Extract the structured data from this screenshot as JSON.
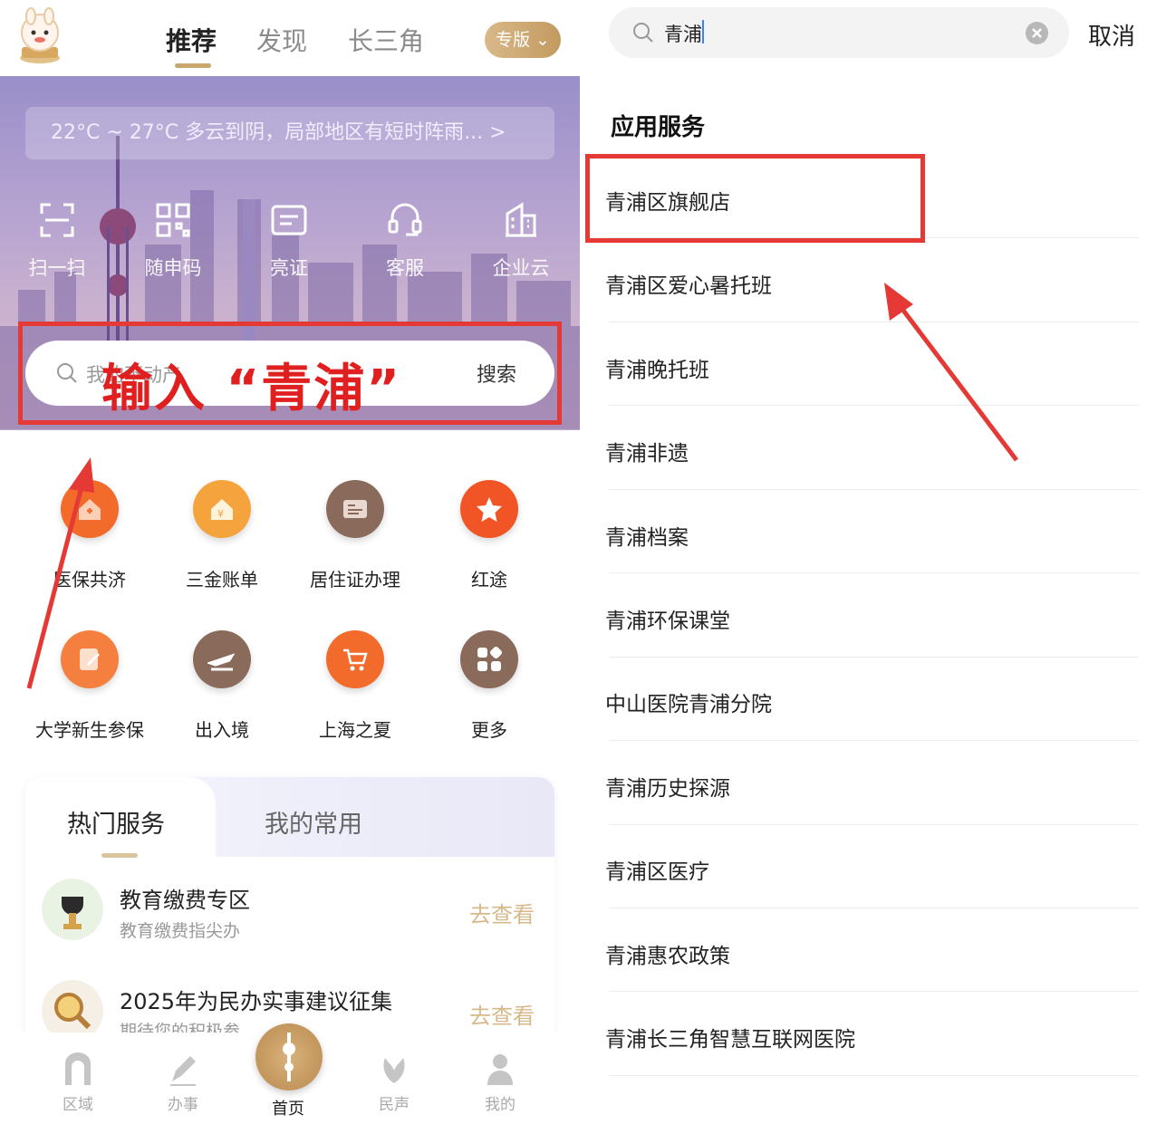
{
  "left": {
    "top_tabs": [
      "推荐",
      "发现",
      "长三角"
    ],
    "edition_label": "专版",
    "weather": "22°C ~ 27°C  多云到阴，局部地区有短时阵雨... >",
    "quick_actions": [
      "扫一扫",
      "随申码",
      "亮证",
      "客服",
      "企业云"
    ],
    "search": {
      "placeholder": "我的不动产",
      "button": "搜索"
    },
    "annotation": "输入 “青浦”",
    "services": [
      "医保共济",
      "三金账单",
      "居住证办理",
      "红途",
      "大学新生参保",
      "出入境",
      "上海之夏",
      "更多"
    ],
    "hot_tabs": [
      "热门服务",
      "我的常用"
    ],
    "hot_items": [
      {
        "title": "教育缴费专区",
        "subtitle": "教育缴费指尖办",
        "action": "去查看"
      },
      {
        "title": "2025年为民办实事建议征集",
        "subtitle": "期待您的积极参",
        "action": "去查看"
      }
    ],
    "bottom_nav": [
      "区域",
      "办事",
      "首页",
      "民声",
      "我的"
    ]
  },
  "right": {
    "search_value": "青浦",
    "cancel": "取消",
    "section_title": "应用服务",
    "results": [
      "青浦区旗舰店",
      "青浦区爱心暑托班",
      "青浦晚托班",
      "青浦非遗",
      "青浦档案",
      "青浦环保课堂",
      "中山医院青浦分院",
      "青浦历史探源",
      "青浦区医疗",
      "青浦惠农政策",
      "青浦长三角智慧互联网医院"
    ]
  },
  "colors": {
    "accent_gold": "#c9a66b",
    "annotation_red": "#e53935",
    "orange": "#f26b2a",
    "brown": "#8a6a5a"
  }
}
